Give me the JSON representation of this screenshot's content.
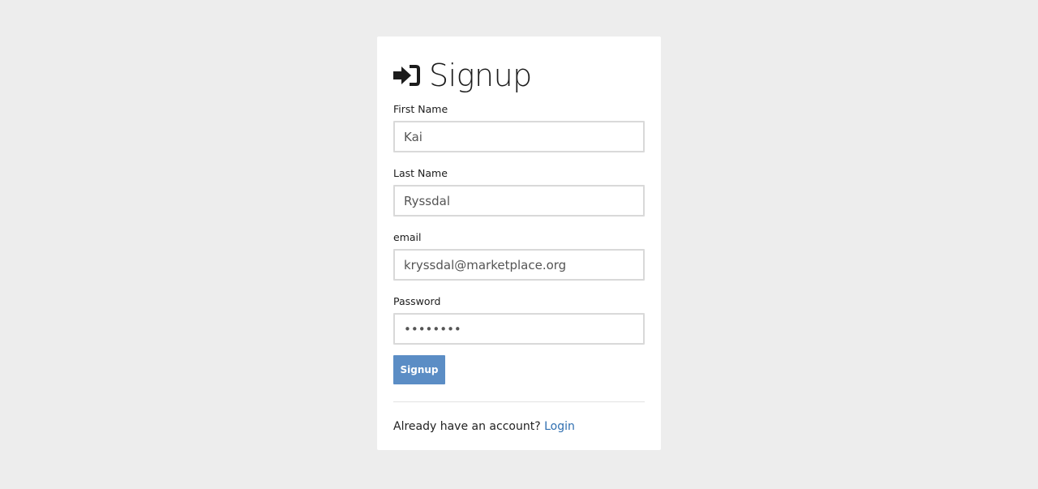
{
  "form": {
    "title": "Signup",
    "title_icon": "sign-in-icon",
    "fields": {
      "first_name": {
        "label": "First Name",
        "value": "Kai"
      },
      "last_name": {
        "label": "Last Name",
        "value": "Ryssdal"
      },
      "email": {
        "label": "email",
        "value": "kryssdal@marketplace.org"
      },
      "password": {
        "label": "Password",
        "value": "••••••••"
      }
    },
    "submit_label": "Signup",
    "footer_text": "Already have an account?",
    "login_link": "Login"
  },
  "colors": {
    "background": "#ededed",
    "card": "#ffffff",
    "button": "#5b8dc5",
    "link": "#2f6fb0"
  }
}
